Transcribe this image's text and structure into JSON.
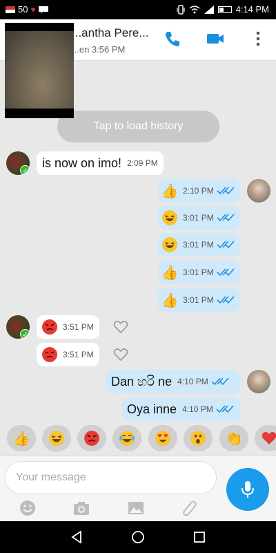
{
  "status_bar": {
    "signal_text": "50",
    "battery_level": 0.3,
    "time": "4:14 PM"
  },
  "header": {
    "contact_name": "...antha Pere...",
    "last_seen": "...en 3:56 PM",
    "icons": [
      "phone-icon",
      "video-camera-icon",
      "more-vert-icon"
    ],
    "accent_color": "#1a8fe0"
  },
  "chat": {
    "load_history_label": "Tap to load history",
    "messages": [
      {
        "dir": "in",
        "text": "is now on imo!",
        "time": "2:09 PM"
      },
      {
        "dir": "out",
        "emoji": "thumbs-up",
        "time": "2:10 PM"
      },
      {
        "dir": "out",
        "emoji": "laughing",
        "time": "3:01 PM"
      },
      {
        "dir": "out",
        "emoji": "laughing",
        "time": "3:01 PM"
      },
      {
        "dir": "out",
        "emoji": "thumbs-up",
        "time": "3:01 PM"
      },
      {
        "dir": "out",
        "emoji": "thumbs-up",
        "time": "3:01 PM"
      },
      {
        "dir": "in",
        "emoji": "angry",
        "time": "3:51 PM"
      },
      {
        "dir": "in",
        "emoji": "angry",
        "time": "3:51 PM"
      },
      {
        "dir": "out",
        "text": "Dan හරි ne",
        "time": "4:10 PM"
      },
      {
        "dir": "out",
        "text": "Oya inne",
        "time": "4:10 PM"
      }
    ]
  },
  "emoji_bar": [
    "thumbs-up",
    "laughing",
    "angry",
    "tears-of-joy",
    "heart-eyes",
    "surprised",
    "clapping",
    "heart"
  ],
  "composer": {
    "placeholder": "Your message",
    "tools": [
      "emoji-icon",
      "camera-icon",
      "gallery-icon",
      "attach-icon"
    ],
    "mic_color": "#1a9bec"
  },
  "colors": {
    "out_bubble": "#cfe9fb",
    "in_bubble": "#ffffff",
    "chat_bg": "#e8e8e8"
  }
}
